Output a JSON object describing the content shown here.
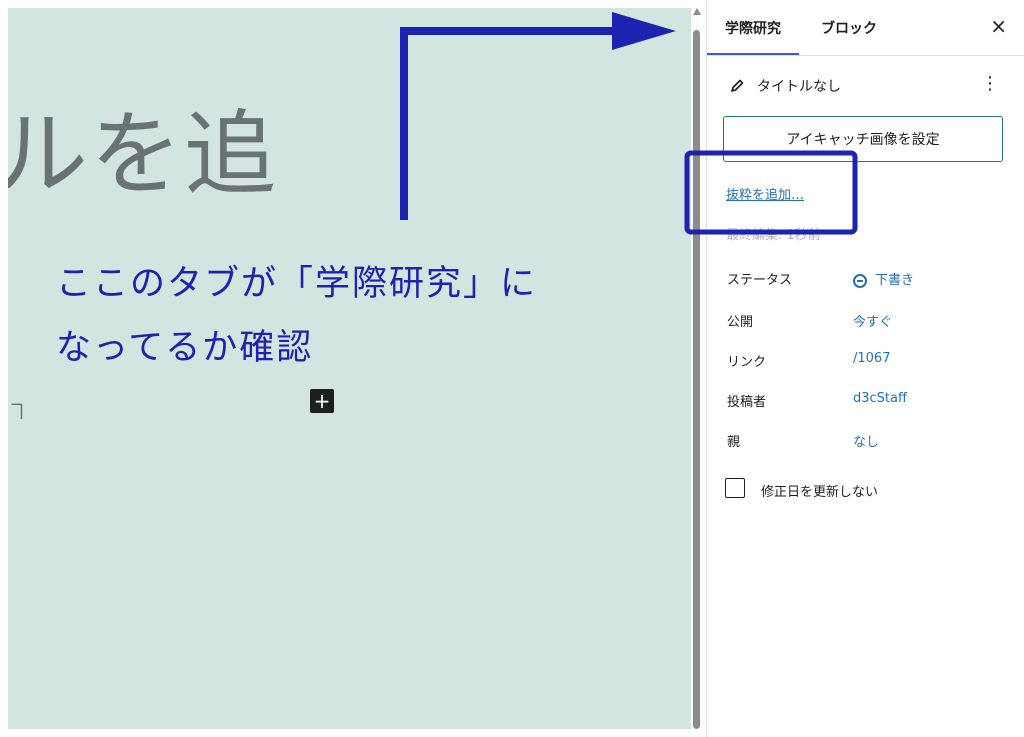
{
  "canvas": {
    "title_fragment": "ルを追",
    "annotation_line1": "ここのタブが「学際研究」に",
    "annotation_line2": "なってるか確認",
    "left_hint": "ヿ",
    "add_block_label": "+"
  },
  "sidebar": {
    "tabs": [
      {
        "label": "学際研究",
        "active": true
      },
      {
        "label": "ブロック",
        "active": false
      }
    ],
    "close_label": "×",
    "doc_title": "タイトルなし",
    "more_label": "⋮",
    "featured_image_button": "アイキャッチ画像を設定",
    "excerpt_link": "抜粋を追加…",
    "last_edited": "最終編集: 1秒前",
    "rows": [
      {
        "label": "ステータス",
        "value": "下書き"
      },
      {
        "label": "公開",
        "value": "今すぐ"
      },
      {
        "label": "リンク",
        "value": "/1067"
      },
      {
        "label": "投稿者",
        "value": "d3cStaff"
      },
      {
        "label": "親",
        "value": "なし"
      }
    ],
    "checkbox_label": "修正日を更新しない"
  },
  "colors": {
    "annotation": "#1d22b0",
    "link": "#2271b1",
    "canvas_bg": "#d3e5e0"
  }
}
